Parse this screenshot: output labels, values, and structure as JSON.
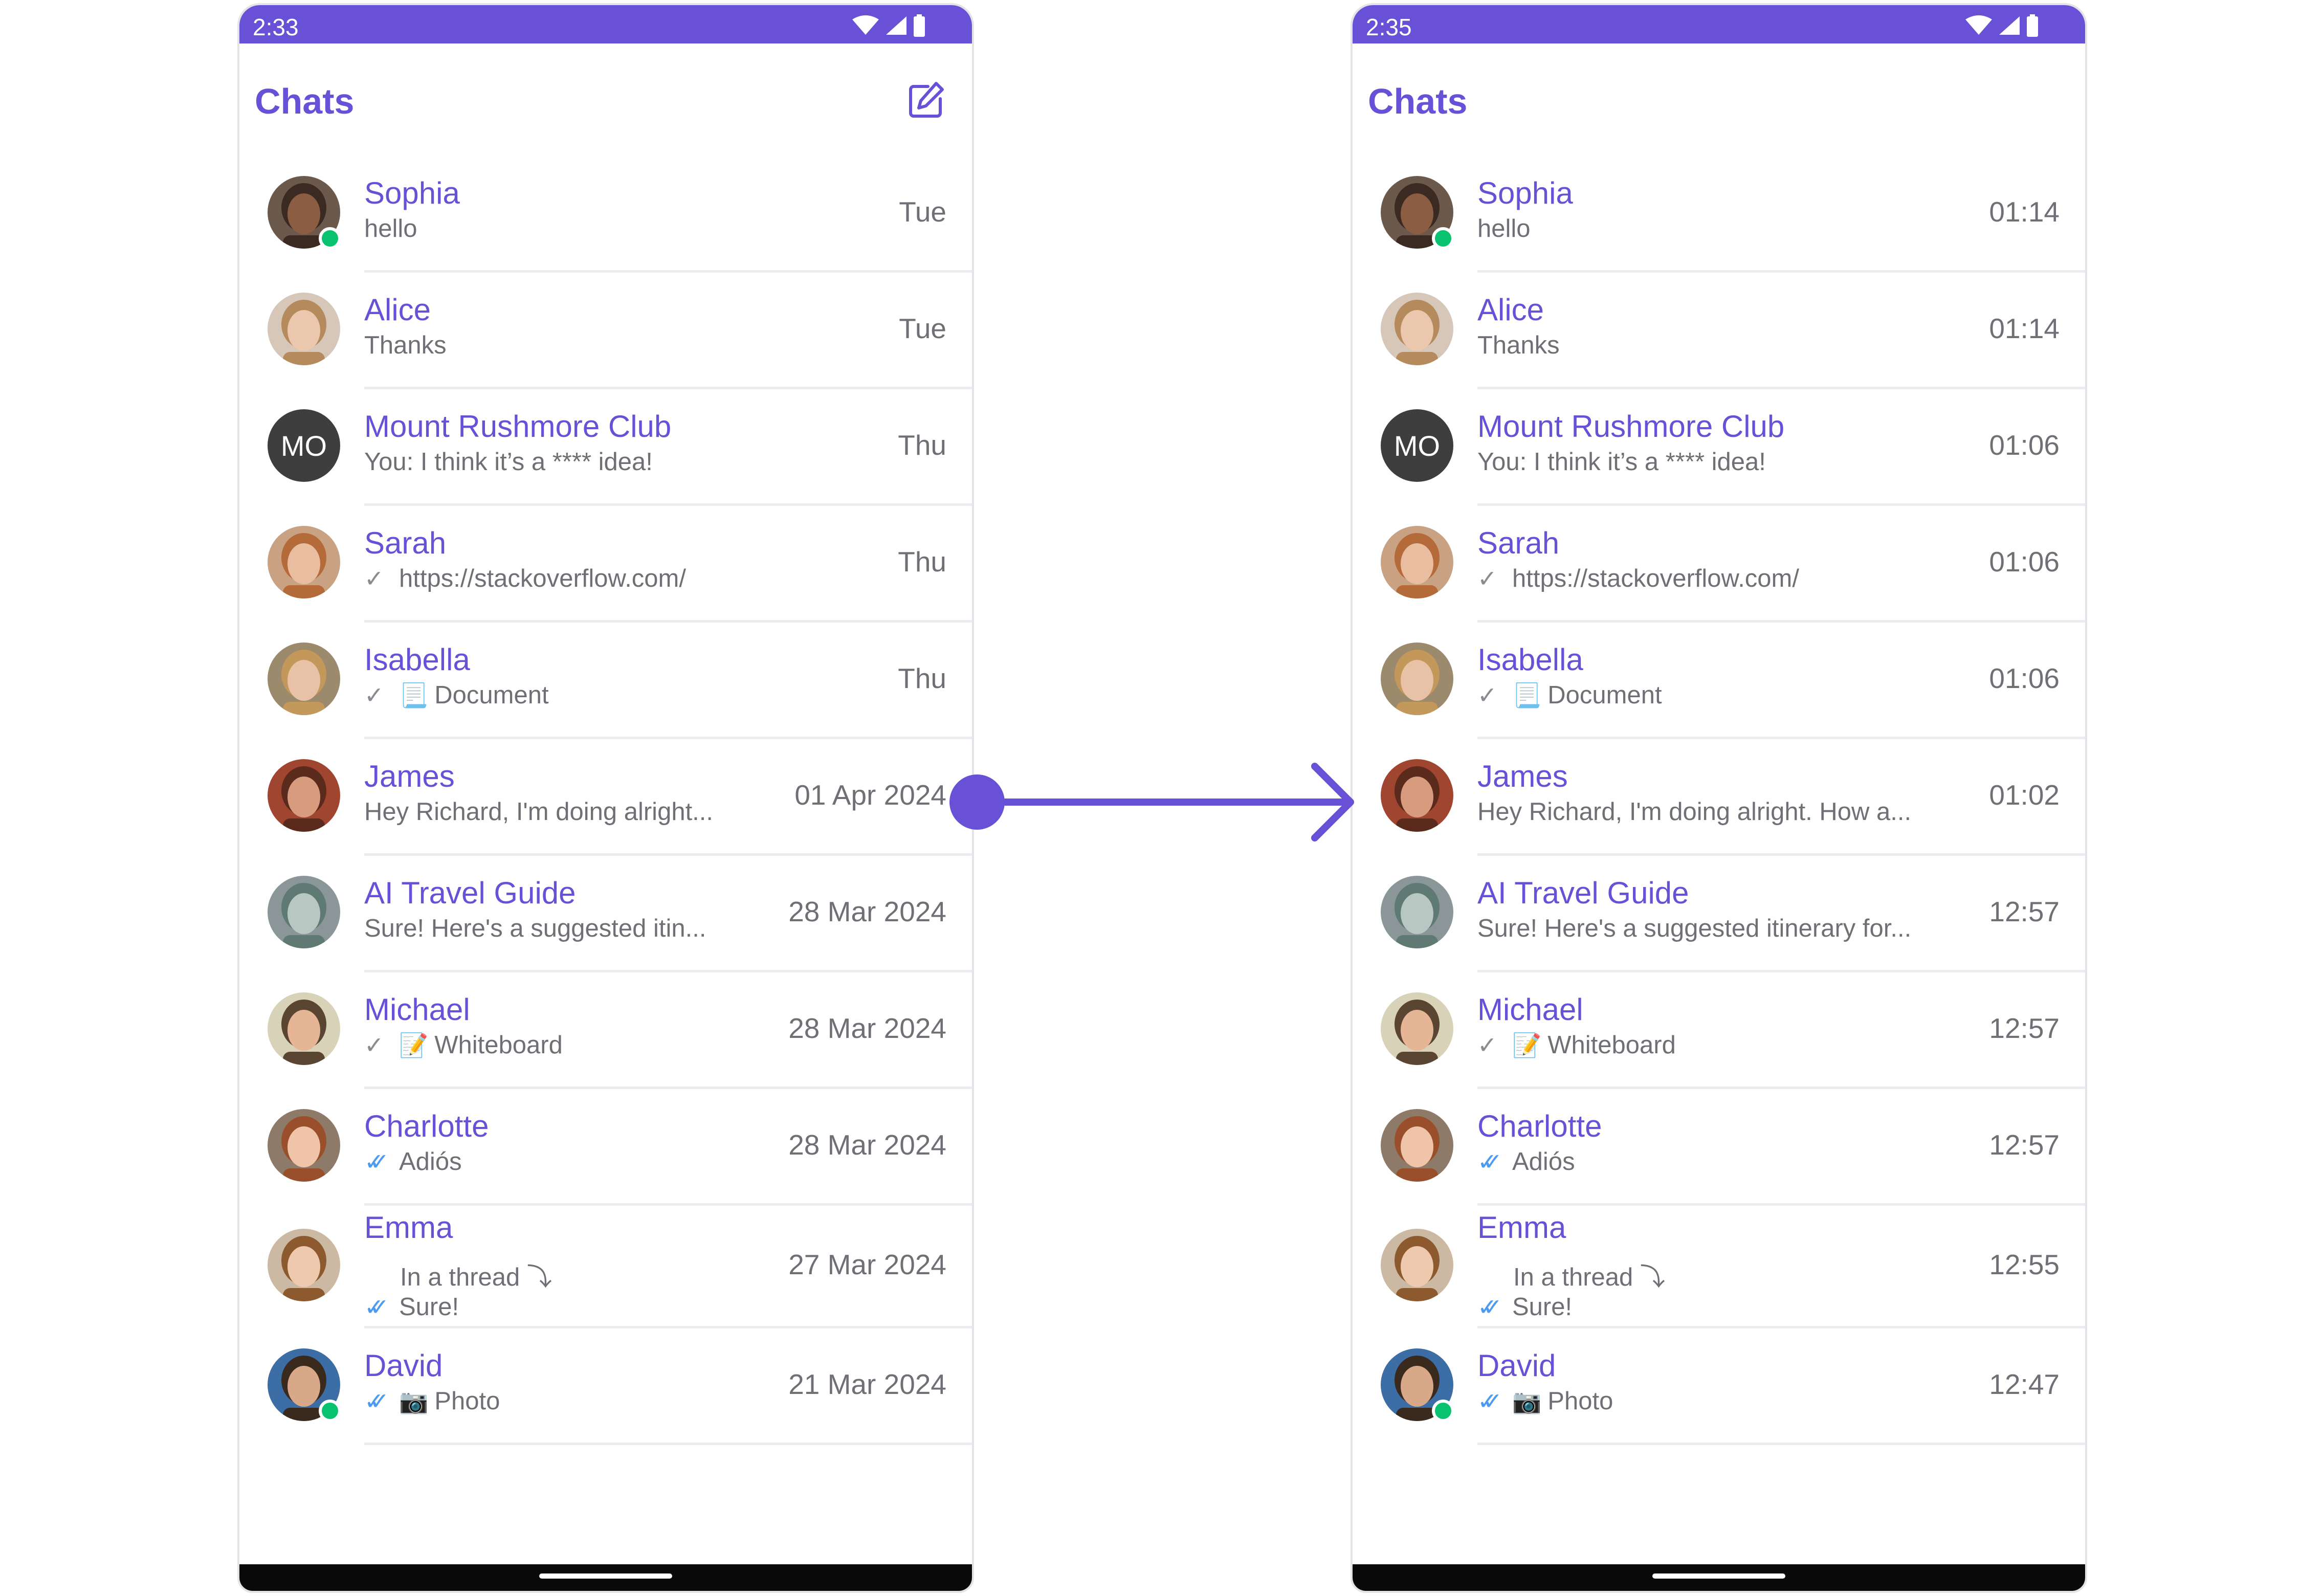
{
  "screens": [
    {
      "status_time": "2:33",
      "title": "Chats",
      "show_compose": true,
      "chats": [
        {
          "name": "Sophia",
          "preview": "hello",
          "time": "Tue",
          "online": true,
          "tick": "",
          "attachment": "",
          "avatar": "face-1"
        },
        {
          "name": "Alice",
          "preview": "Thanks",
          "time": "Tue",
          "online": false,
          "tick": "",
          "attachment": "",
          "avatar": "face-2"
        },
        {
          "name": "Mount Rushmore Club",
          "preview": "You: I think it’s a **** idea!",
          "time": "Thu",
          "online": false,
          "tick": "",
          "attachment": "",
          "avatar": "initials",
          "initials": "MO"
        },
        {
          "name": "Sarah",
          "preview": "https://stackoverflow.com/",
          "time": "Thu",
          "online": false,
          "tick": "sent",
          "attachment": "",
          "avatar": "face-3"
        },
        {
          "name": "Isabella",
          "preview": "Document",
          "time": "Thu",
          "online": false,
          "tick": "sent",
          "attachment": "📃",
          "avatar": "face-4"
        },
        {
          "name": "James",
          "preview": "Hey Richard, I'm doing alright...",
          "time": "01 Apr 2024",
          "online": false,
          "tick": "",
          "attachment": "",
          "avatar": "face-5"
        },
        {
          "name": "AI Travel Guide",
          "preview": "Sure! Here's a suggested itin...",
          "time": "28 Mar 2024",
          "online": false,
          "tick": "",
          "attachment": "",
          "avatar": "statue"
        },
        {
          "name": "Michael",
          "preview": "Whiteboard",
          "time": "28 Mar 2024",
          "online": false,
          "tick": "sent",
          "attachment": "📝",
          "avatar": "face-6"
        },
        {
          "name": "Charlotte",
          "preview": "Adiós",
          "time": "28 Mar 2024",
          "online": false,
          "tick": "read",
          "attachment": "",
          "avatar": "face-7"
        },
        {
          "name": "Emma",
          "thread": "In a thread ⤵",
          "preview": "Sure!",
          "time": "27 Mar 2024",
          "online": false,
          "tick": "read",
          "attachment": "",
          "avatar": "face-8"
        },
        {
          "name": "David",
          "preview": "Photo",
          "time": "21 Mar 2024",
          "online": true,
          "tick": "read",
          "attachment": "📷",
          "avatar": "face-9"
        }
      ]
    },
    {
      "status_time": "2:35",
      "title": "Chats",
      "show_compose": false,
      "chats": [
        {
          "name": "Sophia",
          "preview": "hello",
          "time": "01:14",
          "online": true,
          "tick": "",
          "attachment": "",
          "avatar": "face-1"
        },
        {
          "name": "Alice",
          "preview": "Thanks",
          "time": "01:14",
          "online": false,
          "tick": "",
          "attachment": "",
          "avatar": "face-2"
        },
        {
          "name": "Mount Rushmore Club",
          "preview": "You: I think it’s a **** idea!",
          "time": "01:06",
          "online": false,
          "tick": "",
          "attachment": "",
          "avatar": "initials",
          "initials": "MO"
        },
        {
          "name": "Sarah",
          "preview": "https://stackoverflow.com/",
          "time": "01:06",
          "online": false,
          "tick": "sent",
          "attachment": "",
          "avatar": "face-3"
        },
        {
          "name": "Isabella",
          "preview": "Document",
          "time": "01:06",
          "online": false,
          "tick": "sent",
          "attachment": "📃",
          "avatar": "face-4"
        },
        {
          "name": "James",
          "preview": "Hey Richard, I'm doing alright. How a...",
          "time": "01:02",
          "online": false,
          "tick": "",
          "attachment": "",
          "avatar": "face-5"
        },
        {
          "name": "AI Travel Guide",
          "preview": "Sure! Here's a suggested itinerary for...",
          "time": "12:57",
          "online": false,
          "tick": "",
          "attachment": "",
          "avatar": "statue"
        },
        {
          "name": "Michael",
          "preview": "Whiteboard",
          "time": "12:57",
          "online": false,
          "tick": "sent",
          "attachment": "📝",
          "avatar": "face-6"
        },
        {
          "name": "Charlotte",
          "preview": "Adiós",
          "time": "12:57",
          "online": false,
          "tick": "read",
          "attachment": "",
          "avatar": "face-7"
        },
        {
          "name": "Emma",
          "thread": "In a thread ⤵",
          "preview": "Sure!",
          "time": "12:55",
          "online": false,
          "tick": "read",
          "attachment": "",
          "avatar": "face-8"
        },
        {
          "name": "David",
          "preview": "Photo",
          "time": "12:47",
          "online": true,
          "tick": "read",
          "attachment": "📷",
          "avatar": "face-9"
        }
      ]
    }
  ],
  "colors": {
    "accent": "#6851d6",
    "online": "#09c26f",
    "read_tick": "#4d9bf0"
  }
}
